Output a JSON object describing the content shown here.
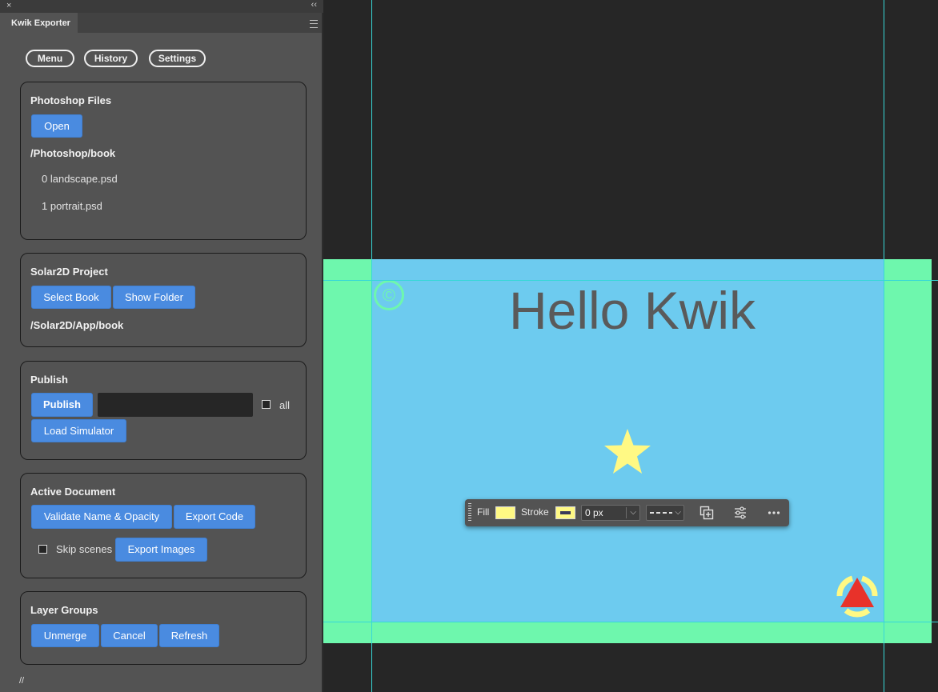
{
  "panel": {
    "title": "Kwik Exporter",
    "close_glyph": "×",
    "collapse_glyph": "‹‹",
    "nav": {
      "menu": "Menu",
      "history": "History",
      "settings": "Settings"
    },
    "photoshop": {
      "title": "Photoshop Files",
      "open": "Open",
      "path": "/Photoshop/book",
      "files": [
        "0 landscape.psd",
        "1 portrait.psd"
      ]
    },
    "solar2d": {
      "title": "Solar2D Project",
      "select_book": "Select Book",
      "show_folder": "Show Folder",
      "path": "/Solar2D/App/book"
    },
    "publish": {
      "title": "Publish",
      "publish": "Publish",
      "input_value": "",
      "all_label": "all",
      "load_simulator": "Load Simulator"
    },
    "active_document": {
      "title": "Active Document",
      "validate": "Validate Name & Opacity",
      "export_code": "Export Code",
      "skip_scenes": "Skip scenes",
      "export_images": "Export Images"
    },
    "layer_groups": {
      "title": "Layer Groups",
      "unmerge": "Unmerge",
      "cancel": "Cancel",
      "refresh": "Refresh"
    },
    "footer": "//"
  },
  "canvas": {
    "heading": "Hello Kwik",
    "copyright_symbol": "©",
    "colors": {
      "bleed": "#6ef7ad",
      "stage": "#6dcbef",
      "guide": "#37d7d7",
      "star": "#fff984",
      "triangle": "#e8322a"
    }
  },
  "toolbar": {
    "fill_label": "Fill",
    "stroke_label": "Stroke",
    "stroke_width": "0 px",
    "icons": [
      "duplicate-icon",
      "adjust-icon",
      "more-icon"
    ]
  }
}
